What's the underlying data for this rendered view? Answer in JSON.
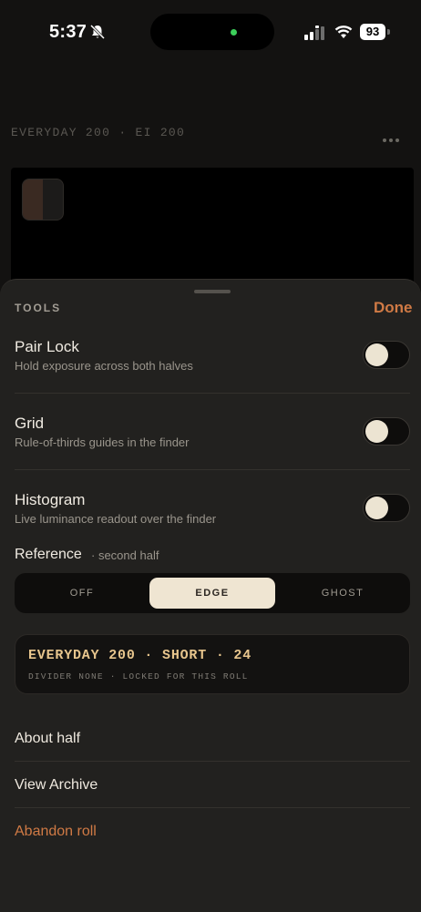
{
  "status_bar": {
    "time": "5:37",
    "battery": "93",
    "icons": [
      "bell-slash-icon",
      "cellular-signal-icon",
      "wifi-icon",
      "battery-icon"
    ]
  },
  "camera": {
    "film_label": "EVERYDAY 200 · EI 200",
    "more_icon": "ellipsis-icon"
  },
  "sheet": {
    "title": "TOOLS",
    "done_label": "Done",
    "rows": [
      {
        "title": "Pair Lock",
        "subtitle": "Hold exposure across both halves",
        "enabled": false
      },
      {
        "title": "Grid",
        "subtitle": "Rule-of-thirds guides in the finder",
        "enabled": false
      },
      {
        "title": "Histogram",
        "subtitle": "Live luminance readout over the finder",
        "enabled": false
      }
    ],
    "reference": {
      "label": "Reference",
      "sublabel": "second half",
      "options": [
        "OFF",
        "EDGE",
        "GHOST"
      ],
      "selected": "EDGE"
    },
    "roll": {
      "title": "EVERYDAY 200 · SHORT · 24",
      "subtitle": "DIVIDER NONE · LOCKED FOR THIS ROLL"
    },
    "links": [
      "About half",
      "View Archive",
      "Abandon roll"
    ]
  },
  "colors": {
    "accent": "#d07a45",
    "roll_title": "#e7c58d",
    "sheet_bg": "#22211f",
    "segment_active": "#efe5d2"
  }
}
